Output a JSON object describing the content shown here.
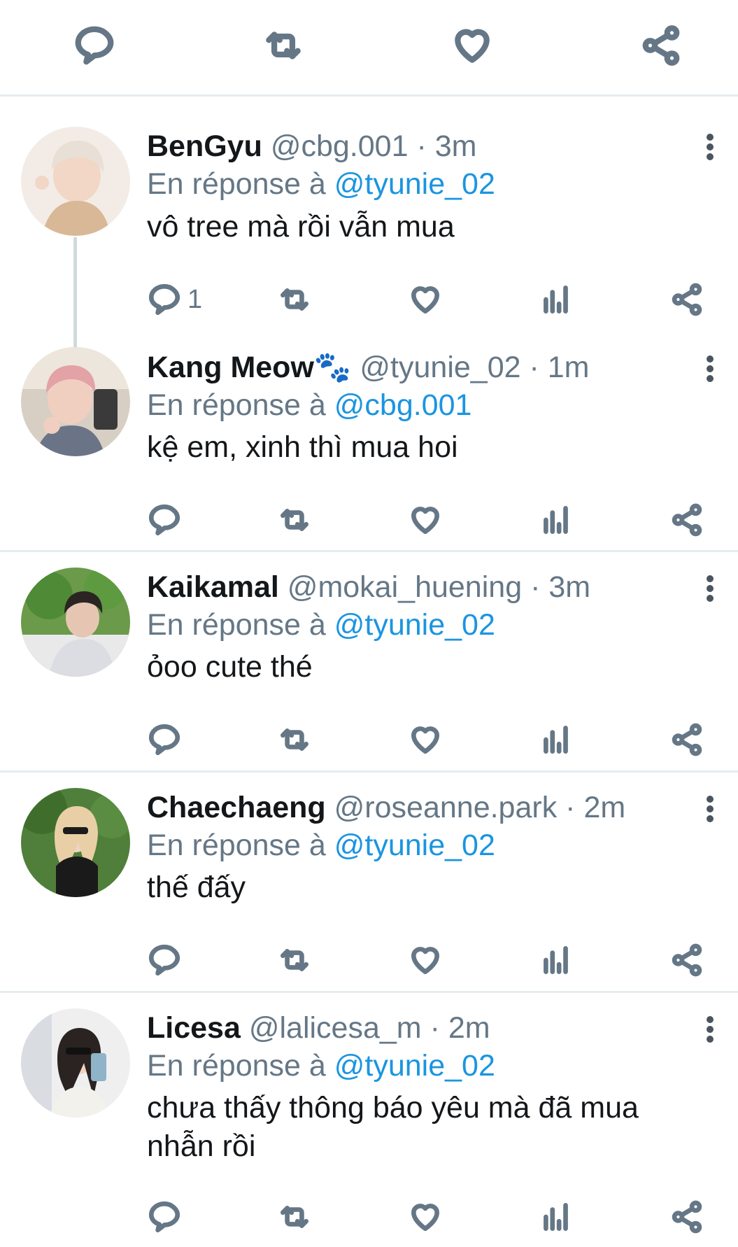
{
  "top_actions": {
    "icons": [
      "reply-icon",
      "retweet-icon",
      "like-icon",
      "share-icon"
    ]
  },
  "labels": {
    "reply_prefix": "En réponse à"
  },
  "colors": {
    "mention": "#1b95e0",
    "secondary": "#657786",
    "divider": "#e6ecf0"
  },
  "replies": [
    {
      "name": "BenGyu",
      "handle": "@cbg.001",
      "time": "3m",
      "reply_to": "@tyunie_02",
      "text": "vô tree mà rồi vẫn mua",
      "reply_count": "1"
    },
    {
      "name": "Kang Meow🐾",
      "handle": "@tyunie_02",
      "time": "1m",
      "reply_to": "@cbg.001",
      "text": "kệ em, xinh thì mua hoi",
      "reply_count": ""
    },
    {
      "name": "Kaikamal",
      "handle": "@mokai_huening",
      "time": "3m",
      "reply_to": "@tyunie_02",
      "text": "ỏoo cute thé",
      "reply_count": ""
    },
    {
      "name": "Chaechaeng",
      "handle": "@roseanne.park",
      "time": "2m",
      "reply_to": "@tyunie_02",
      "text": "thế đấy",
      "reply_count": ""
    },
    {
      "name": "Licesa",
      "handle": "@lalicesa_m",
      "time": "2m",
      "reply_to": "@tyunie_02",
      "text": "chưa thấy thông báo yêu mà đã mua nhẫn rồi",
      "reply_count": ""
    }
  ]
}
